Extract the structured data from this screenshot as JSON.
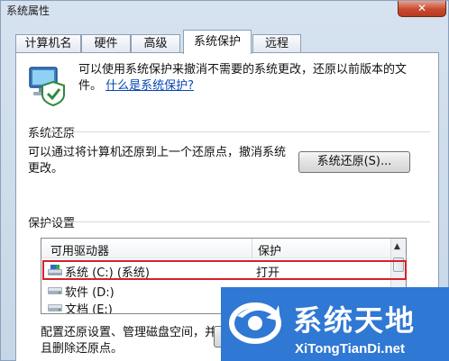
{
  "window": {
    "title": "系统属性",
    "close_label": "✕"
  },
  "tabs": [
    {
      "label": "计算机名",
      "active": false
    },
    {
      "label": "硬件",
      "active": false
    },
    {
      "label": "高级",
      "active": false
    },
    {
      "label": "系统保护",
      "active": true
    },
    {
      "label": "远程",
      "active": false
    }
  ],
  "intro": {
    "text": "可以使用系统保护来撤消不需要的系统更改，还原以前版本的文件。",
    "link": "什么是系统保护?",
    "icon": "computer-shield-icon"
  },
  "restore": {
    "group_label": "系统还原",
    "description": "可以通过将计算机还原到上一个还原点，撤消系统更改。",
    "button_label": "系统还原(S)..."
  },
  "protection": {
    "group_label": "保护设置",
    "columns": [
      "可用驱动器",
      "保护"
    ],
    "rows": [
      {
        "name": "系统 (C:) (系统)",
        "protection": "打开",
        "icon": "system-drive-icon",
        "selected": true
      },
      {
        "name": "软件 (D:)",
        "protection": "",
        "icon": "drive-icon",
        "selected": false
      },
      {
        "name": "文档 (E:)",
        "protection": "",
        "icon": "drive-icon",
        "selected": false
      }
    ],
    "config_description": "配置还原设置、管理磁盘空间，并且删除还原点。",
    "config_button_label": ""
  },
  "watermark": {
    "title": "系统天地",
    "url": "XiTongTianDi.net"
  },
  "colors": {
    "highlight": "#d8202b",
    "link": "#0645b5",
    "watermark_bg": "#2f78d3"
  }
}
